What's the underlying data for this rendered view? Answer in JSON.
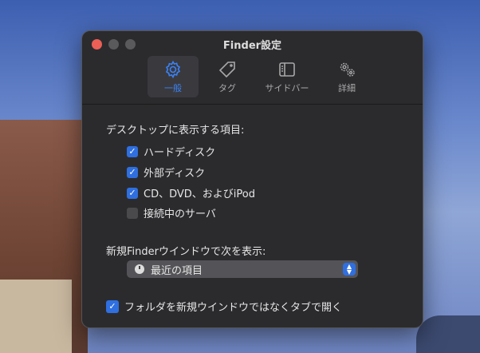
{
  "window": {
    "title": "Finder設定"
  },
  "toolbar": {
    "tabs": [
      {
        "label": "一般"
      },
      {
        "label": "タグ"
      },
      {
        "label": "サイドバー"
      },
      {
        "label": "詳細"
      }
    ]
  },
  "general": {
    "desktop_heading": "デスクトップに表示する項目:",
    "items": [
      {
        "label": "ハードディスク",
        "checked": true
      },
      {
        "label": "外部ディスク",
        "checked": true
      },
      {
        "label": "CD、DVD、およびiPod",
        "checked": true
      },
      {
        "label": "接続中のサーバ",
        "checked": false
      }
    ],
    "new_window_heading": "新規Finderウインドウで次を表示:",
    "new_window_value": "最近の項目",
    "open_in_tabs": {
      "label": "フォルダを新規ウインドウではなくタブで開く",
      "checked": true
    }
  },
  "colors": {
    "accent": "#2f6fe0",
    "close": "#ec5f57"
  }
}
